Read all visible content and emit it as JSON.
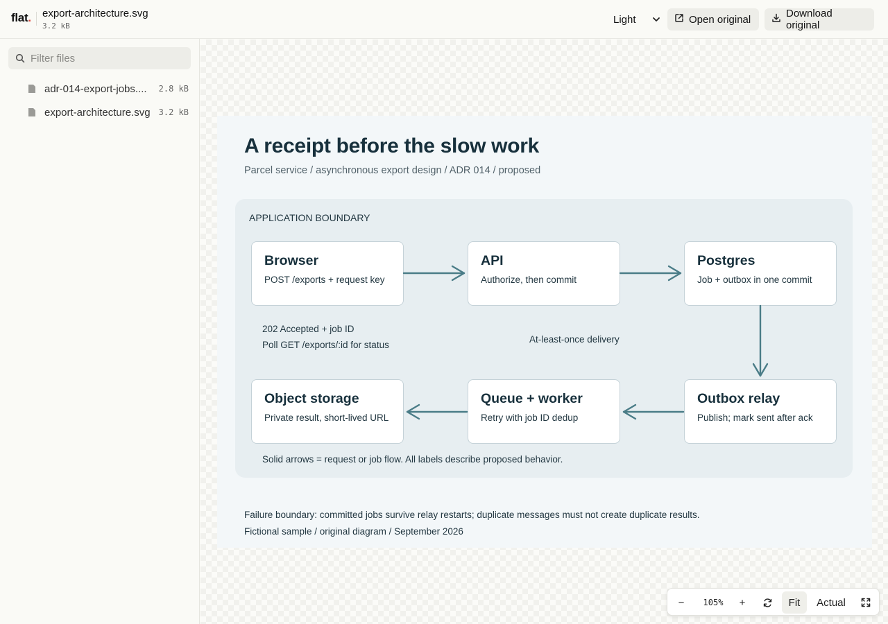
{
  "header": {
    "logo": "flat",
    "logo_dot": ".",
    "file_name": "export-architecture.svg",
    "file_size": "3.2 kB",
    "theme": "Light",
    "open_label": "Open original",
    "download_label": "Download original"
  },
  "sidebar": {
    "filter_placeholder": "Filter files",
    "files": [
      {
        "name": "adr-014-export-jobs....",
        "size": "2.8 kB"
      },
      {
        "name": "export-architecture.svg",
        "size": "3.2 kB"
      }
    ]
  },
  "diagram": {
    "title": "A receipt before the slow work",
    "subtitle": "Parcel service / asynchronous export design / ADR 014 / proposed",
    "boundary_label": "APPLICATION BOUNDARY",
    "nodes": [
      {
        "title": "Browser",
        "desc": "POST /exports + request key"
      },
      {
        "title": "API",
        "desc": "Authorize, then commit"
      },
      {
        "title": "Postgres",
        "desc": "Job + outbox in one commit"
      },
      {
        "title": "Object storage",
        "desc": "Private result, short-lived URL"
      },
      {
        "title": "Queue + worker",
        "desc": "Retry with job ID dedup"
      },
      {
        "title": "Outbox relay",
        "desc": "Publish; mark sent after ack"
      }
    ],
    "label_accepted": "202 Accepted + job ID",
    "label_poll": "Poll GET /exports/:id for status",
    "label_delivery": "At-least-once delivery",
    "legend": "Solid arrows = request or job flow. All labels describe proposed behavior.",
    "footer_failure": "Failure boundary: committed jobs survive relay restarts; duplicate messages must not create duplicate results.",
    "footer_note": "Fictional sample / original diagram / September 2026",
    "arrow_color": "#4a7c87"
  },
  "zoom": {
    "minus": "−",
    "level": "105%",
    "plus": "+",
    "fit": "Fit",
    "actual": "Actual"
  }
}
